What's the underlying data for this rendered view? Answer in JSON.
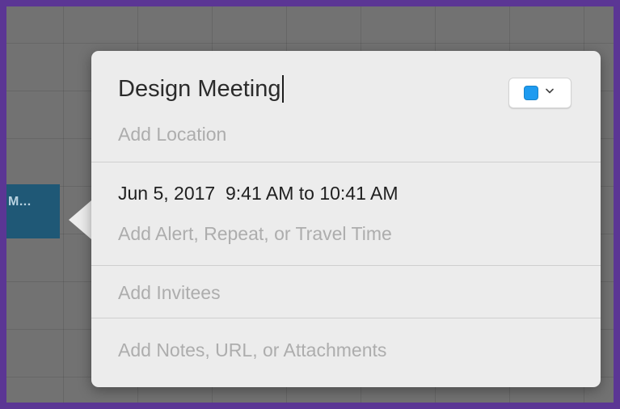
{
  "calendar": {
    "event_block_label": "M..."
  },
  "popover": {
    "title": "Design Meeting",
    "location_placeholder": "Add Location",
    "color_picker": {
      "selected_color": "#1e9bf0",
      "chevron_icon": "chevron-down-icon"
    },
    "datetime": "Jun 5, 2017  9:41 AM to 10:41 AM",
    "alert_placeholder": "Add Alert, Repeat, or Travel Time",
    "invitees_placeholder": "Add Invitees",
    "notes_placeholder": "Add Notes, URL, or Attachments"
  },
  "colors": {
    "frame_border": "#5b3694",
    "calendar_background": "#727272",
    "event_block": "#1f5876",
    "popover_background": "#ececec"
  }
}
